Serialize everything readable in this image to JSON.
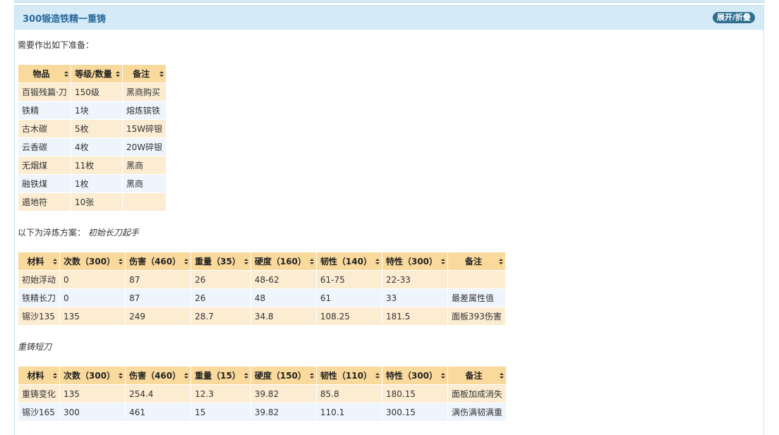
{
  "header": {
    "title": "300锻造铁精一重铸",
    "toggle_label": "展开/折叠"
  },
  "intro_text": "需要作出如下准备：",
  "prep_table": {
    "headers": [
      "物品",
      "等级/数量",
      "备注"
    ],
    "rows": [
      [
        "百锻残篇·刀",
        "150级",
        "黑商购买"
      ],
      [
        "铁精",
        "1块",
        "熔炼镔铁"
      ],
      [
        "古木碳",
        "5枚",
        "15W碎银"
      ],
      [
        "云香碳",
        "4枚",
        "20W碎银"
      ],
      [
        "无烟煤",
        "11枚",
        "黑商"
      ],
      [
        "融铁煤",
        "1枚",
        "黑商"
      ],
      [
        "遁地符",
        "10张",
        ""
      ]
    ]
  },
  "plan_label": "以下为淬炼方案：",
  "plan_name": "初始长刀起手",
  "plan_table": {
    "headers": [
      "材料",
      "次数（300）",
      "伤害（460）",
      "重量（35）",
      "硬度（160）",
      "韧性（140）",
      "特性（300）",
      "备注"
    ],
    "rows": [
      [
        "初始浮动",
        "0",
        "87",
        "26",
        "48-62",
        "61-75",
        "22-33",
        ""
      ],
      [
        "铁精长刀",
        "0",
        "87",
        "26",
        "48",
        "61",
        "33",
        "最差属性值"
      ],
      [
        "锡沙135",
        "135",
        "249",
        "28.7",
        "34.8",
        "108.25",
        "181.5",
        "面板393伤害"
      ]
    ]
  },
  "recast_label": "重铸短刀",
  "recast_table": {
    "headers": [
      "材料",
      "次数（300）",
      "伤害（460）",
      "重量（15）",
      "硬度（150）",
      "韧性（110）",
      "特性（300）",
      "备注"
    ],
    "rows": [
      [
        "重铸变化",
        "135",
        "254.4",
        "12.3",
        "39.82",
        "85.8",
        "180.15",
        "面板加成消失"
      ],
      [
        "锡沙165",
        "300",
        "461",
        "15",
        "39.82",
        "110.1",
        "300.15",
        "满伤满韧满重"
      ]
    ]
  },
  "colors": {
    "header_bg": "#d4ebf7",
    "title": "#2b6a9b",
    "toggle_bg": "#2f6f8f",
    "th_bg": "#f9d99c",
    "row_odd": "#fbecd2",
    "row_even": "#eef5fc"
  }
}
